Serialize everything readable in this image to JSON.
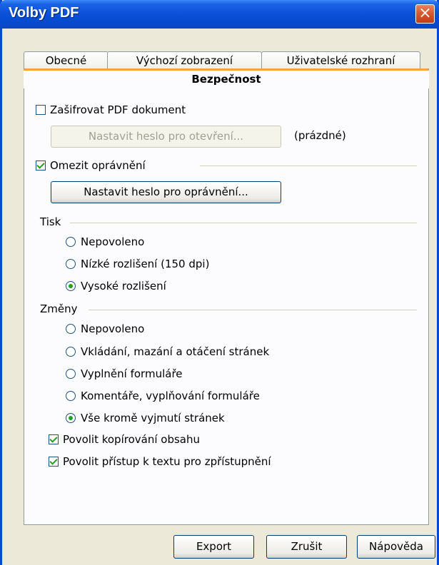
{
  "window": {
    "title": "Volby PDF",
    "close_glyph": "×"
  },
  "tabs": [
    {
      "label": "Obecné"
    },
    {
      "label": "Výchozí zobrazení"
    },
    {
      "label": "Uživatelské rozhraní"
    },
    {
      "label": "Bezpečnost",
      "active": true
    }
  ],
  "encrypt": {
    "label": "Zašifrovat PDF dokument",
    "checked": false
  },
  "open_password": {
    "button_label": "Nastavit heslo pro otevření...",
    "status": "(prázdné)",
    "enabled": false
  },
  "restrict": {
    "label": "Omezit oprávnění",
    "checked": true
  },
  "perm_password": {
    "button_label": "Nastavit heslo pro oprávnění..."
  },
  "print": {
    "label": "Tisk",
    "options": [
      "Nepovoleno",
      "Nízké rozlišení (150 dpi)",
      "Vysoké rozlišení"
    ],
    "selected": 2
  },
  "changes": {
    "label": "Změny",
    "options": [
      "Nepovoleno",
      "Vkládání, mazání a otáčení stránek",
      "Vyplnění formuláře",
      "Komentáře, vyplňování formuláře",
      "Vše kromě vyjmutí stránek"
    ],
    "selected": 4
  },
  "copy": {
    "label": "Povolit kopírování obsahu",
    "checked": true
  },
  "access": {
    "label": "Povolit přístup k textu pro zpřístupnění",
    "checked": true
  },
  "buttons": {
    "export": "Export",
    "cancel": "Zrušit",
    "help": "Nápověda"
  }
}
